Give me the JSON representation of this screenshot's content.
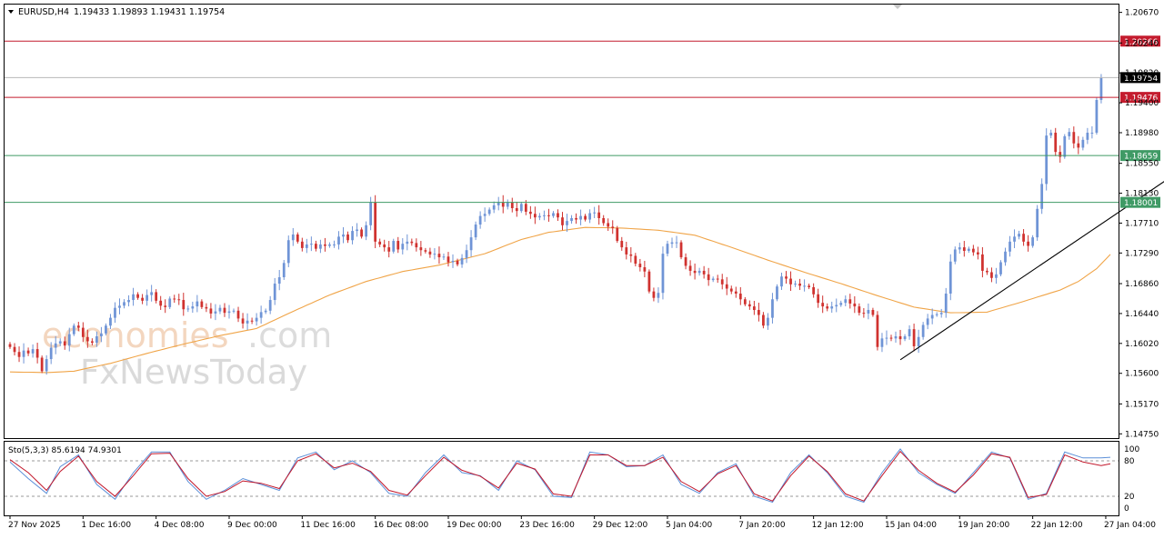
{
  "header": {
    "symbol": "EURUSD,H4",
    "ohlc": "1.19433 1.19893 1.19431 1.19754"
  },
  "watermark": {
    "line1a": "economies",
    "line1b": ".com",
    "line2": "FxNewsToday"
  },
  "stochastic": {
    "label": "Sto(5,3,3) 85.6194 74.9301",
    "levels": [
      "100",
      "80",
      "20",
      "0"
    ]
  },
  "colors": {
    "bull": "#6f94d6",
    "bear": "#d0322f",
    "ma": "#f0a447",
    "resistance": "#c41c2e",
    "support": "#3f9a65",
    "price": "#000000",
    "stoch_main": "#5b8fd8",
    "stoch_signal": "#c2162a",
    "trendline": "#000000"
  },
  "chart_data": {
    "type": "candlestick",
    "symbol": "EURUSD",
    "timeframe": "H4",
    "y_ticks": [
      "1.20670",
      "1.20240",
      "1.19820",
      "1.19400",
      "1.18980",
      "1.18550",
      "1.18130",
      "1.17710",
      "1.17290",
      "1.16860",
      "1.16440",
      "1.16020",
      "1.15600",
      "1.15170",
      "1.14750"
    ],
    "ylim": [
      1.1469,
      1.2078
    ],
    "x_labels": [
      "27 Nov 2025",
      "1 Dec 16:00",
      "4 Dec 08:00",
      "9 Dec 00:00",
      "11 Dec 16:00",
      "16 Dec 08:00",
      "19 Dec 00:00",
      "23 Dec 16:00",
      "29 Dec 12:00",
      "5 Jan 04:00",
      "7 Jan 20:00",
      "12 Jan 12:00",
      "15 Jan 04:00",
      "19 Jan 20:00",
      "22 Jan 12:00",
      "27 Jan 04:00"
    ],
    "bar_count": 242,
    "hlines": [
      {
        "name": "resistance-2",
        "value": 1.20266,
        "label": "1.20266",
        "color": "#c41c2e"
      },
      {
        "name": "current-price",
        "value": 1.19754,
        "label": "1.19754",
        "color": "#000000"
      },
      {
        "name": "resistance-1",
        "value": 1.19476,
        "label": "1.19476",
        "color": "#c41c2e"
      },
      {
        "name": "support-1",
        "value": 1.18659,
        "label": "1.18659",
        "color": "#3f9a65"
      },
      {
        "name": "support-2",
        "value": 1.18001,
        "label": "1.18001",
        "color": "#3f9a65"
      }
    ],
    "trendline": {
      "from": [
        195,
        1.1579
      ],
      "to": [
        267,
        1.1891
      ]
    },
    "closes": [
      1.1597,
      1.159,
      1.1583,
      1.1592,
      1.1588,
      1.1594,
      1.1582,
      1.1563,
      1.158,
      1.1596,
      1.1602,
      1.1605,
      1.1599,
      1.1615,
      1.1627,
      1.1624,
      1.1611,
      1.1605,
      1.1603,
      1.1612,
      1.1616,
      1.1627,
      1.1638,
      1.1652,
      1.1655,
      1.166,
      1.1663,
      1.1671,
      1.1666,
      1.1662,
      1.167,
      1.1674,
      1.1662,
      1.1655,
      1.1653,
      1.1665,
      1.1664,
      1.1663,
      1.165,
      1.1651,
      1.1654,
      1.1661,
      1.1653,
      1.1651,
      1.1644,
      1.1647,
      1.1652,
      1.1645,
      1.1647,
      1.1648,
      1.1637,
      1.163,
      1.1634,
      1.1633,
      1.1638,
      1.1646,
      1.1648,
      1.1663,
      1.1686,
      1.1695,
      1.1715,
      1.1747,
      1.1755,
      1.1745,
      1.1736,
      1.1741,
      1.1742,
      1.1735,
      1.1741,
      1.1739,
      1.1741,
      1.1741,
      1.1752,
      1.1755,
      1.1747,
      1.176,
      1.1762,
      1.1752,
      1.1768,
      1.18,
      1.1745,
      1.1741,
      1.1737,
      1.1731,
      1.1746,
      1.1734,
      1.1742,
      1.1745,
      1.1743,
      1.1737,
      1.1733,
      1.1731,
      1.1727,
      1.1728,
      1.1723,
      1.1724,
      1.1716,
      1.1718,
      1.1713,
      1.1722,
      1.1733,
      1.1751,
      1.1769,
      1.1781,
      1.1784,
      1.179,
      1.1796,
      1.18,
      1.1794,
      1.18,
      1.1792,
      1.1788,
      1.1798,
      1.1787,
      1.1784,
      1.1779,
      1.1781,
      1.1782,
      1.1781,
      1.1785,
      1.1779,
      1.1768,
      1.1774,
      1.1778,
      1.1776,
      1.1781,
      1.1776,
      1.1785,
      1.1786,
      1.1778,
      1.1771,
      1.1766,
      1.1764,
      1.1746,
      1.1737,
      1.1727,
      1.1725,
      1.1714,
      1.1709,
      1.1703,
      1.1675,
      1.1666,
      1.1673,
      1.1728,
      1.1742,
      1.1744,
      1.1744,
      1.1723,
      1.1711,
      1.1704,
      1.1701,
      1.1704,
      1.1699,
      1.1691,
      1.1693,
      1.1692,
      1.1685,
      1.1679,
      1.1675,
      1.1672,
      1.1664,
      1.1657,
      1.1654,
      1.1649,
      1.1642,
      1.1627,
      1.1638,
      1.1664,
      1.1682,
      1.1696,
      1.1693,
      1.1685,
      1.1686,
      1.1683,
      1.1683,
      1.1681,
      1.1671,
      1.1659,
      1.1654,
      1.1651,
      1.1654,
      1.1656,
      1.1659,
      1.1664,
      1.1658,
      1.1654,
      1.1645,
      1.1644,
      1.1649,
      1.1642,
      1.1597,
      1.1609,
      1.161,
      1.1609,
      1.1612,
      1.1608,
      1.1612,
      1.1622,
      1.1598,
      1.1611,
      1.1628,
      1.1637,
      1.1642,
      1.1643,
      1.1645,
      1.1672,
      1.1717,
      1.1734,
      1.1737,
      1.1732,
      1.1735,
      1.173,
      1.1727,
      1.1704,
      1.1702,
      1.1694,
      1.1699,
      1.1716,
      1.1731,
      1.1745,
      1.1752,
      1.1756,
      1.1745,
      1.1739,
      1.1751,
      1.1791,
      1.1826,
      1.1894,
      1.1898,
      1.1871,
      1.1864,
      1.1893,
      1.1899,
      1.1883,
      1.1877,
      1.1888,
      1.1898,
      1.1898,
      1.1944,
      1.1975
    ],
    "ma_line": [
      [
        0,
        1.1562
      ],
      [
        8,
        1.1561
      ],
      [
        14,
        1.1563
      ],
      [
        22,
        1.1574
      ],
      [
        30,
        1.1588
      ],
      [
        38,
        1.1601
      ],
      [
        46,
        1.1613
      ],
      [
        54,
        1.1623
      ],
      [
        62,
        1.1647
      ],
      [
        70,
        1.167
      ],
      [
        78,
        1.1689
      ],
      [
        86,
        1.1703
      ],
      [
        94,
        1.1712
      ],
      [
        104,
        1.1728
      ],
      [
        112,
        1.1748
      ],
      [
        118,
        1.1758
      ],
      [
        126,
        1.1765
      ],
      [
        134,
        1.1764
      ],
      [
        142,
        1.1761
      ],
      [
        150,
        1.1754
      ],
      [
        158,
        1.1737
      ],
      [
        166,
        1.1719
      ],
      [
        174,
        1.1702
      ],
      [
        182,
        1.1686
      ],
      [
        190,
        1.1669
      ],
      [
        198,
        1.1653
      ],
      [
        206,
        1.1645
      ],
      [
        214,
        1.1646
      ],
      [
        222,
        1.1661
      ],
      [
        230,
        1.1677
      ],
      [
        234,
        1.1689
      ],
      [
        238,
        1.1707
      ],
      [
        241,
        1.1727
      ]
    ],
    "stochastic_main": [
      [
        0,
        78
      ],
      [
        4,
        50
      ],
      [
        8,
        25
      ],
      [
        11,
        70
      ],
      [
        15,
        90
      ],
      [
        19,
        40
      ],
      [
        23,
        15
      ],
      [
        27,
        60
      ],
      [
        31,
        95
      ],
      [
        35,
        95
      ],
      [
        39,
        45
      ],
      [
        43,
        15
      ],
      [
        47,
        30
      ],
      [
        51,
        50
      ],
      [
        55,
        40
      ],
      [
        59,
        30
      ],
      [
        63,
        85
      ],
      [
        67,
        95
      ],
      [
        71,
        65
      ],
      [
        75,
        80
      ],
      [
        79,
        60
      ],
      [
        83,
        25
      ],
      [
        87,
        20
      ],
      [
        91,
        60
      ],
      [
        95,
        90
      ],
      [
        99,
        60
      ],
      [
        103,
        55
      ],
      [
        107,
        30
      ],
      [
        111,
        80
      ],
      [
        115,
        65
      ],
      [
        119,
        20
      ],
      [
        123,
        18
      ],
      [
        127,
        95
      ],
      [
        131,
        90
      ],
      [
        135,
        70
      ],
      [
        139,
        72
      ],
      [
        143,
        90
      ],
      [
        147,
        40
      ],
      [
        151,
        25
      ],
      [
        155,
        60
      ],
      [
        159,
        75
      ],
      [
        163,
        20
      ],
      [
        167,
        10
      ],
      [
        171,
        60
      ],
      [
        175,
        90
      ],
      [
        179,
        60
      ],
      [
        183,
        20
      ],
      [
        187,
        10
      ],
      [
        191,
        60
      ],
      [
        195,
        100
      ],
      [
        199,
        60
      ],
      [
        203,
        40
      ],
      [
        207,
        25
      ],
      [
        211,
        60
      ],
      [
        215,
        95
      ],
      [
        219,
        85
      ],
      [
        223,
        15
      ],
      [
        227,
        25
      ],
      [
        231,
        95
      ],
      [
        235,
        85
      ],
      [
        239,
        85
      ],
      [
        241,
        86
      ]
    ],
    "stochastic_signal": [
      [
        0,
        82
      ],
      [
        4,
        60
      ],
      [
        8,
        30
      ],
      [
        11,
        62
      ],
      [
        15,
        88
      ],
      [
        19,
        45
      ],
      [
        23,
        20
      ],
      [
        27,
        55
      ],
      [
        31,
        92
      ],
      [
        35,
        93
      ],
      [
        39,
        50
      ],
      [
        43,
        20
      ],
      [
        47,
        28
      ],
      [
        51,
        46
      ],
      [
        55,
        42
      ],
      [
        59,
        33
      ],
      [
        63,
        80
      ],
      [
        67,
        92
      ],
      [
        71,
        68
      ],
      [
        75,
        76
      ],
      [
        79,
        62
      ],
      [
        83,
        30
      ],
      [
        87,
        22
      ],
      [
        91,
        55
      ],
      [
        95,
        86
      ],
      [
        99,
        64
      ],
      [
        103,
        54
      ],
      [
        107,
        34
      ],
      [
        111,
        76
      ],
      [
        115,
        66
      ],
      [
        119,
        24
      ],
      [
        123,
        20
      ],
      [
        127,
        90
      ],
      [
        131,
        90
      ],
      [
        135,
        72
      ],
      [
        139,
        72
      ],
      [
        143,
        86
      ],
      [
        147,
        45
      ],
      [
        151,
        28
      ],
      [
        155,
        58
      ],
      [
        159,
        72
      ],
      [
        163,
        24
      ],
      [
        167,
        12
      ],
      [
        171,
        55
      ],
      [
        175,
        88
      ],
      [
        179,
        62
      ],
      [
        183,
        24
      ],
      [
        187,
        12
      ],
      [
        191,
        55
      ],
      [
        195,
        96
      ],
      [
        199,
        64
      ],
      [
        203,
        42
      ],
      [
        207,
        27
      ],
      [
        211,
        56
      ],
      [
        215,
        92
      ],
      [
        219,
        86
      ],
      [
        223,
        18
      ],
      [
        227,
        23
      ],
      [
        231,
        90
      ],
      [
        235,
        78
      ],
      [
        239,
        72
      ],
      [
        241,
        75
      ]
    ]
  }
}
